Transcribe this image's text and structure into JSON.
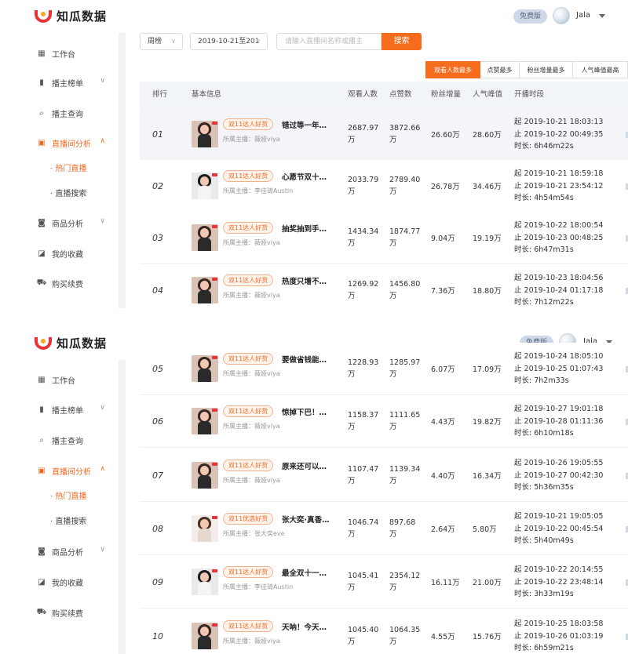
{
  "app": {
    "logo_text": "知瓜数据",
    "plan_badge": "免费版",
    "user_name": "Jala"
  },
  "sidebar": {
    "items": [
      {
        "label": "工作台",
        "icon": "grid-icon"
      },
      {
        "label": "播主榜单",
        "icon": "bar-chart-icon",
        "expandable": true
      },
      {
        "label": "播主查询",
        "icon": "search-icon"
      },
      {
        "label": "直播间分析",
        "icon": "tv-icon",
        "expandable": true,
        "active": true
      },
      {
        "label": "商品分析",
        "icon": "shopping-bag-icon",
        "expandable": true
      },
      {
        "label": "我的收藏",
        "icon": "bookmark-icon"
      },
      {
        "label": "购买续费",
        "icon": "cart-icon"
      }
    ],
    "sub_items": [
      {
        "label": "· 热门直播",
        "active": true
      },
      {
        "label": "· 直播搜索",
        "active": false
      }
    ]
  },
  "filters": {
    "period": "周榜",
    "date_range": "2019-10-21至201",
    "search_placeholder": "请输入直播间名称或播主",
    "search_button": "搜索"
  },
  "sort_tabs": [
    {
      "label": "观看人数最多",
      "active": true
    },
    {
      "label": "点赞最多",
      "active": false
    },
    {
      "label": "粉丝增量最多",
      "active": false
    },
    {
      "label": "人气峰值最高",
      "active": false
    }
  ],
  "columns": [
    "排行",
    "基本信息",
    "观看人数",
    "点赞数",
    "粉丝增量",
    "人气峰值",
    "开播时段"
  ],
  "rows": [
    {
      "rank": "01",
      "tag": "双11达人好货",
      "title": "错过等一年…",
      "host": "所属主播：薇娅viya",
      "views": "2687.97万",
      "likes": "3872.66万",
      "fans": "26.60万",
      "peak": "28.60万",
      "start": "起 2019-10-21 18:03:13",
      "end": "止 2019-10-22 00:49:35",
      "duration": "时长: 6h46m22s"
    },
    {
      "rank": "02",
      "tag": "双11达人好货",
      "title": "心愿节双十…",
      "host": "所属主播：李佳琦Austin",
      "views": "2033.79万",
      "likes": "2789.40万",
      "fans": "26.78万",
      "peak": "34.46万",
      "start": "起 2019-10-21 18:59:18",
      "end": "止 2019-10-21 23:54:12",
      "duration": "时长: 4h54m54s"
    },
    {
      "rank": "03",
      "tag": "双11达人好货",
      "title": "抽奖抽到手…",
      "host": "所属主播：薇娅viya",
      "views": "1434.34万",
      "likes": "1874.77万",
      "fans": "9.04万",
      "peak": "19.19万",
      "start": "起 2019-10-22 18:00:54",
      "end": "止 2019-10-23 00:48:25",
      "duration": "时长: 6h47m31s"
    },
    {
      "rank": "04",
      "tag": "双11达人好货",
      "title": "热度只增不…",
      "host": "所属主播：薇娅viya",
      "views": "1269.92万",
      "likes": "1456.80万",
      "fans": "7.36万",
      "peak": "18.80万",
      "start": "起 2019-10-23 18:04:56",
      "end": "止 2019-10-24 01:17:18",
      "duration": "时长: 7h12m22s"
    },
    {
      "rank": "05",
      "tag": "双11达人好货",
      "title": "要做省钱能…",
      "host": "所属主播：薇娅viya",
      "views": "1228.93万",
      "likes": "1285.97万",
      "fans": "6.07万",
      "peak": "17.09万",
      "start": "起 2019-10-24 18:05:10",
      "end": "止 2019-10-25 01:07:43",
      "duration": "时长: 7h2m33s"
    },
    {
      "rank": "06",
      "tag": "双11达人好货",
      "title": "惊掉下巴！…",
      "host": "所属主播：薇娅viya",
      "views": "1158.37万",
      "likes": "1111.65万",
      "fans": "4.43万",
      "peak": "19.82万",
      "start": "起 2019-10-27 19:01:18",
      "end": "止 2019-10-28 01:11:36",
      "duration": "时长: 6h10m18s"
    },
    {
      "rank": "07",
      "tag": "双11达人好货",
      "title": "原来还可以…",
      "host": "所属主播：薇娅viya",
      "views": "1107.47万",
      "likes": "1139.34万",
      "fans": "4.40万",
      "peak": "16.34万",
      "start": "起 2019-10-26 19:05:55",
      "end": "止 2019-10-27 00:42:30",
      "duration": "时长: 5h36m35s"
    },
    {
      "rank": "08",
      "tag": "双11优选好货",
      "title": "张大奕·真香…",
      "host": "所属主播：张大奕eve",
      "views": "1046.74万",
      "likes": "897.68万",
      "fans": "2.64万",
      "peak": "5.80万",
      "start": "起 2019-10-21 19:05:05",
      "end": "止 2019-10-22 00:45:54",
      "duration": "时长: 5h40m49s"
    },
    {
      "rank": "09",
      "tag": "双11达人好货",
      "title": "最全双十一…",
      "host": "所属主播：李佳琦Austin",
      "views": "1045.41万",
      "likes": "2354.12万",
      "fans": "16.11万",
      "peak": "21.00万",
      "start": "起 2019-10-22 20:14:55",
      "end": "止 2019-10-22 23:48:14",
      "duration": "时长: 3h33m19s"
    },
    {
      "rank": "10",
      "tag": "双11达人好货",
      "title": "天呐！今天…",
      "host": "所属主播：薇娅viya",
      "views": "1045.40万",
      "likes": "1064.35万",
      "fans": "4.55万",
      "peak": "15.76万",
      "start": "起 2019-10-25 18:03:58",
      "end": "止 2019-10-26 01:03:19",
      "duration": "时长: 6h59m21s"
    }
  ]
}
